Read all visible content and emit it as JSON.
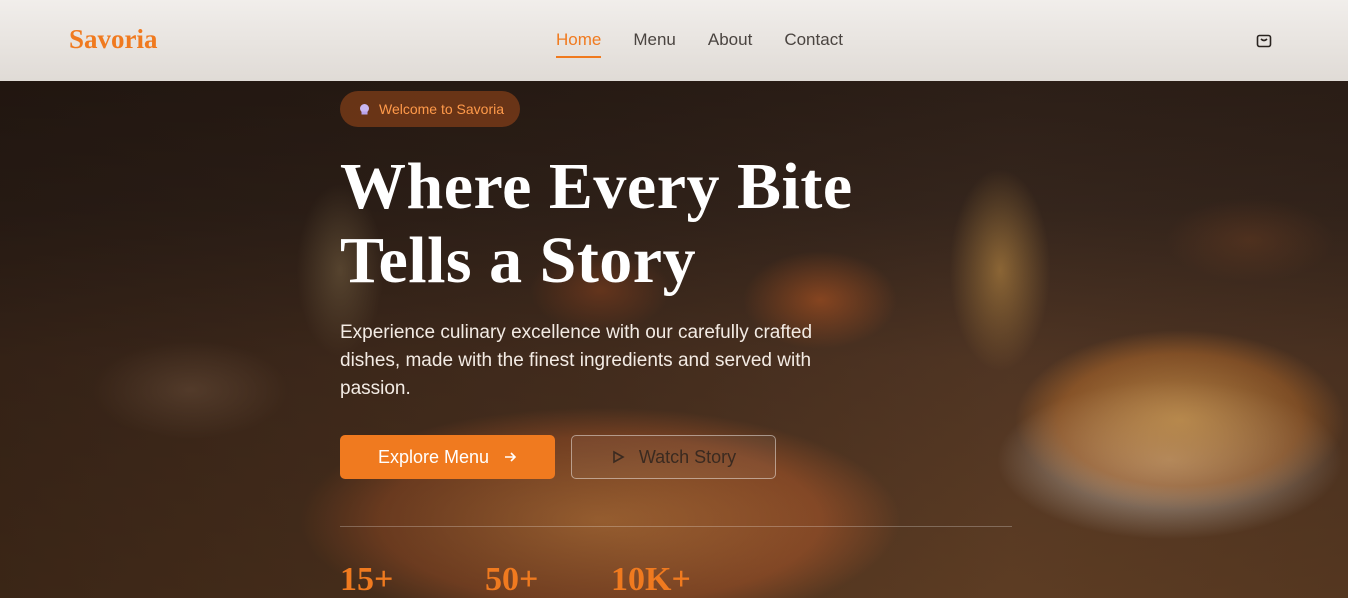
{
  "header": {
    "brand": "Savoria",
    "nav": [
      {
        "label": "Home",
        "active": true
      },
      {
        "label": "Menu",
        "active": false
      },
      {
        "label": "About",
        "active": false
      },
      {
        "label": "Contact",
        "active": false
      }
    ],
    "cart_icon": "shopping-bag-icon"
  },
  "hero": {
    "badge_icon": "chef-hat-icon",
    "badge": "Welcome to Savoria",
    "headline_line1": "Where Every Bite",
    "headline_line2": "Tells a Story",
    "subtitle": "Experience culinary excellence with our carefully crafted dishes, made with the finest ingredients and served with passion.",
    "primary_button": "Explore Menu",
    "primary_button_icon": "arrow-right-icon",
    "secondary_button": "Watch Story",
    "secondary_button_icon": "play-icon"
  },
  "stats": [
    {
      "value": "15+"
    },
    {
      "value": "50+"
    },
    {
      "value": "10K+"
    }
  ],
  "colors": {
    "accent": "#f07a1f",
    "header_bg": "#e8e4e0",
    "headline": "#ffffff"
  }
}
